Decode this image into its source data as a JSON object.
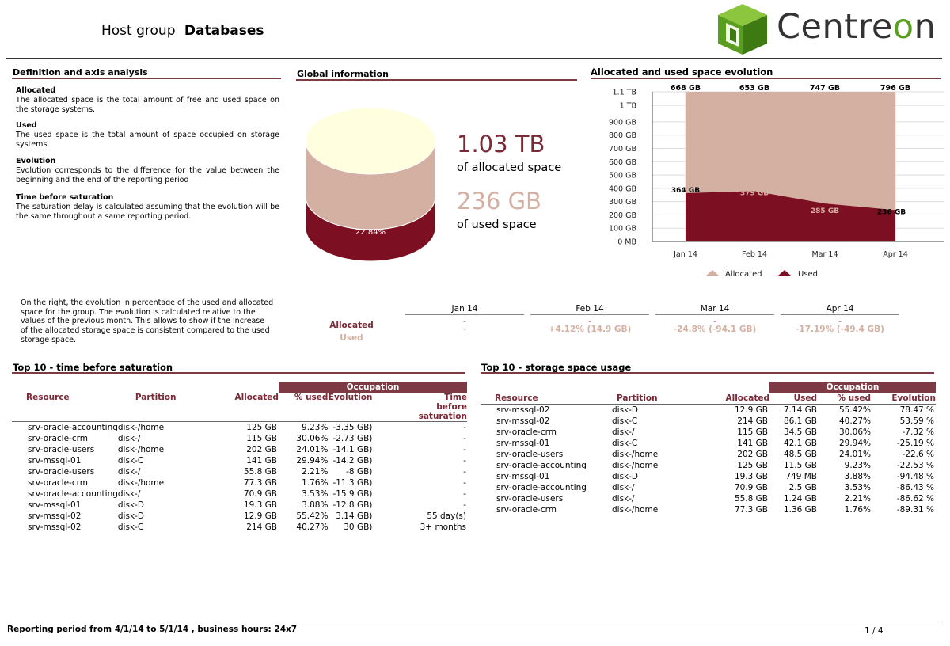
{
  "header": {
    "prefix": "Host group",
    "group_name": "Databases",
    "brand": "Centreon"
  },
  "definitions": {
    "title": "Definition and axis analysis",
    "items": [
      {
        "term": "Allocated",
        "text": "The allocated space is the total amount of free and used space on the storage systems."
      },
      {
        "term": "Used",
        "text": "The used space is the total amount of space occupied on storage systems."
      },
      {
        "term": "Evolution",
        "text": "Evolution corresponds to the difference for the value between the beginning and the end of the reporting period"
      },
      {
        "term": "Time before saturation",
        "text": "The saturation delay is calculated assuming that the evolution will be the same throughout a same reporting period."
      }
    ]
  },
  "global": {
    "title": "Global information",
    "allocated_value": "1.03 TB",
    "allocated_label": "of allocated space",
    "used_value": "236 GB",
    "used_label": "of used space",
    "used_percent": "22.84%",
    "colors": {
      "allocated": "#d4b0a3",
      "used": "#7d0f22",
      "top": "#ffffe0"
    }
  },
  "chart": {
    "title": "Allocated and used space evolution",
    "legend_allocated": "Allocated",
    "legend_used": "Used"
  },
  "chart_data": {
    "type": "area",
    "categories": [
      "Jan 14",
      "Feb 14",
      "Mar 14",
      "Apr 14"
    ],
    "y_ticks": [
      "0 MB",
      "100 GB",
      "200 GB",
      "300 GB",
      "400 GB",
      "500 GB",
      "600 GB",
      "700 GB",
      "800 GB",
      "900 GB",
      "1 TB",
      "1.1 TB"
    ],
    "ylim_gb": [
      0,
      1126
    ],
    "series": [
      {
        "name": "Allocated",
        "values_gb": [
          1126,
          1126,
          1126,
          1126
        ],
        "top_labels": [
          "668 GB",
          "653 GB",
          "747 GB",
          "796 GB"
        ],
        "color": "#d4b0a3"
      },
      {
        "name": "Used",
        "values_gb": [
          364,
          379,
          285,
          236
        ],
        "labels": [
          "364 GB",
          "379 GB",
          "285 GB",
          "236 GB"
        ],
        "color": "#7d0f22"
      }
    ],
    "grid": true,
    "legend": "bottom"
  },
  "evolution": {
    "note": "On the right, the evolution in percentage of the used and allocated space for the group. The evolution is calculated relative to the values of the previous month. This allows to show if the increase of the allocated storage space is consistent compared to the used storage space.",
    "row_allocated": "Allocated",
    "row_used": "Used",
    "months": [
      {
        "month": "Jan 14",
        "allocated": "-",
        "used": "-"
      },
      {
        "month": "Feb 14",
        "allocated": "-",
        "used": "+4.12% (14.9 GB)"
      },
      {
        "month": "Mar 14",
        "allocated": "-",
        "used": "-24.8% (-94.1 GB)"
      },
      {
        "month": "Apr 14",
        "allocated": "-",
        "used": "-17.19% (-49.4 GB)"
      }
    ]
  },
  "saturation": {
    "title": "Top 10 - time before saturation",
    "occupation": "Occupation",
    "headers": {
      "resource": "Resource",
      "partition": "Partition",
      "allocated": "Allocated",
      "used": "% used",
      "evolution": "Evolution",
      "time": "Time before saturation"
    },
    "rows": [
      [
        "srv-oracle-accounting",
        "disk-/home",
        "125 GB",
        "9.23%",
        "-3.35 GB)",
        "-"
      ],
      [
        "srv-oracle-crm",
        "disk-/",
        "115 GB",
        "30.06%",
        "-2.73 GB)",
        "-"
      ],
      [
        "srv-oracle-users",
        "disk-/home",
        "202 GB",
        "24.01%",
        "-14.1 GB)",
        "-"
      ],
      [
        "srv-mssql-01",
        "disk-C",
        "141 GB",
        "29.94%",
        "-14.2 GB)",
        "-"
      ],
      [
        "srv-oracle-users",
        "disk-/",
        "55.8 GB",
        "2.21%",
        "-8 GB)",
        "-"
      ],
      [
        "srv-oracle-crm",
        "disk-/home",
        "77.3 GB",
        "1.76%",
        "-11.3 GB)",
        "-"
      ],
      [
        "srv-oracle-accounting",
        "disk-/",
        "70.9 GB",
        "3.53%",
        "-15.9 GB)",
        "-"
      ],
      [
        "srv-mssql-01",
        "disk-D",
        "19.3 GB",
        "3.88%",
        "-12.8 GB)",
        "-"
      ],
      [
        "srv-mssql-02",
        "disk-D",
        "12.9 GB",
        "55.42%",
        "3.14 GB)",
        "55 day(s)"
      ],
      [
        "srv-mssql-02",
        "disk-C",
        "214 GB",
        "40.27%",
        "30 GB)",
        "3+ months"
      ]
    ]
  },
  "usage": {
    "title": "Top 10 - storage space usage",
    "occupation": "Occupation",
    "headers": {
      "resource": "Resource",
      "partition": "Partition",
      "allocated": "Allocated",
      "used": "Used",
      "pct": "% used",
      "evolution": "Evolution"
    },
    "rows": [
      [
        "srv-mssql-02",
        "disk-D",
        "12.9 GB",
        "7.14 GB",
        "55.42%",
        "78.47 %"
      ],
      [
        "srv-mssql-02",
        "disk-C",
        "214 GB",
        "86.1 GB",
        "40.27%",
        "53.59 %"
      ],
      [
        "srv-oracle-crm",
        "disk-/",
        "115 GB",
        "34.5 GB",
        "30.06%",
        "-7.32 %"
      ],
      [
        "srv-mssql-01",
        "disk-C",
        "141 GB",
        "42.1 GB",
        "29.94%",
        "-25.19 %"
      ],
      [
        "srv-oracle-users",
        "disk-/home",
        "202 GB",
        "48.5 GB",
        "24.01%",
        "-22.6 %"
      ],
      [
        "srv-oracle-accounting",
        "disk-/home",
        "125 GB",
        "11.5 GB",
        "9.23%",
        "-22.53 %"
      ],
      [
        "srv-mssql-01",
        "disk-D",
        "19.3 GB",
        "749 MB",
        "3.88%",
        "-94.48 %"
      ],
      [
        "srv-oracle-accounting",
        "disk-/",
        "70.9 GB",
        "2.5 GB",
        "3.53%",
        "-86.43 %"
      ],
      [
        "srv-oracle-users",
        "disk-/",
        "55.8 GB",
        "1.24 GB",
        "2.21%",
        "-86.62 %"
      ],
      [
        "srv-oracle-crm",
        "disk-/home",
        "77.3 GB",
        "1.36 GB",
        "1.76%",
        "-89.31 %"
      ]
    ]
  },
  "footer": {
    "period": "Reporting period from 4/1/14 to 5/1/14 , business hours: 24x7",
    "page": "1 / 4"
  }
}
